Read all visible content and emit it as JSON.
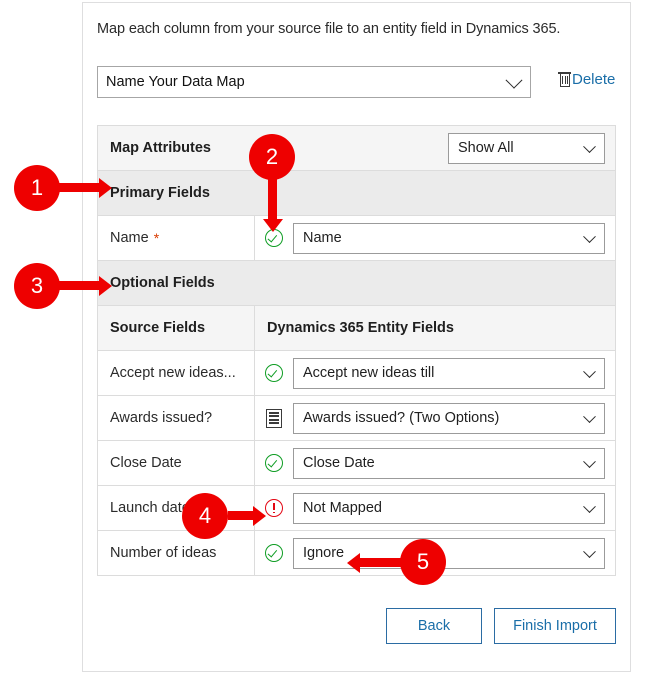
{
  "dialog": {
    "intro_text": "Map each column from your source file to an entity field in Dynamics 365.",
    "map_name_value": "Name Your Data Map",
    "delete_label": "Delete"
  },
  "attributes_header": {
    "title": "Map Attributes",
    "filter_value": "Show All"
  },
  "sections": {
    "primary": "Primary Fields",
    "optional": "Optional Fields"
  },
  "column_headers": {
    "source": "Source Fields",
    "target": "Dynamics 365 Entity Fields"
  },
  "primary_rows": [
    {
      "source": "Name",
      "required_marker": "*",
      "status": "ok",
      "mapped_value": "Name"
    }
  ],
  "optional_rows": [
    {
      "source": "Accept new ideas...",
      "status": "ok",
      "mapped_value": "Accept new ideas till"
    },
    {
      "source": "Awards issued?",
      "status": "list",
      "mapped_value": "Awards issued? (Two Options)"
    },
    {
      "source": "Close Date",
      "status": "ok",
      "mapped_value": "Close Date"
    },
    {
      "source": "Launch date",
      "status": "error",
      "mapped_value": "Not Mapped"
    },
    {
      "source": "Number of ideas",
      "status": "ok",
      "mapped_value": "Ignore"
    }
  ],
  "footer": {
    "back_label": "Back",
    "finish_label": "Finish Import"
  },
  "annotations": [
    {
      "number": "1"
    },
    {
      "number": "2"
    },
    {
      "number": "3"
    },
    {
      "number": "4"
    },
    {
      "number": "5"
    }
  ],
  "colors": {
    "callout_red": "#ee0000",
    "status_ok_green": "#0f9d24",
    "status_error_red": "#e30613",
    "link_blue": "#1a6ea8",
    "button_border_blue": "#2b6ca3",
    "required_star": "#d83b01"
  }
}
